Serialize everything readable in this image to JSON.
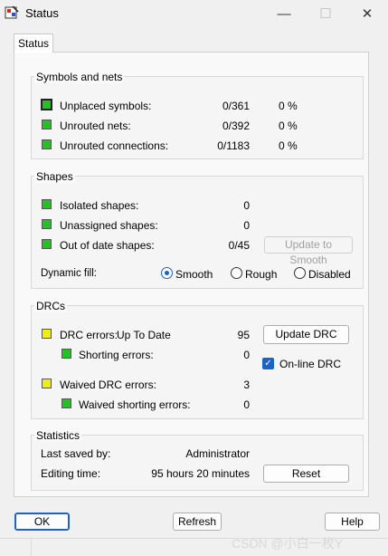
{
  "window": {
    "title": "Status",
    "minimize": "—",
    "maximize": "☐",
    "close": "✕"
  },
  "tab": "Status",
  "symbols": {
    "heading": "Symbols and nets",
    "rows": [
      {
        "label": "Unplaced symbols:",
        "value": "0/361",
        "percent": "0 %",
        "color": "#22c222"
      },
      {
        "label": "Unrouted nets:",
        "value": "0/392",
        "percent": "0 %",
        "color": "#22c222"
      },
      {
        "label": "Unrouted connections:",
        "value": "0/1183",
        "percent": "0 %",
        "color": "#22c222"
      }
    ]
  },
  "shapes": {
    "heading": "Shapes",
    "rows": [
      {
        "label": "Isolated shapes:",
        "value": "0"
      },
      {
        "label": "Unassigned shapes:",
        "value": "0"
      },
      {
        "label": "Out of date shapes:",
        "value": "0/45"
      }
    ],
    "update_button": "Update to Smooth",
    "dynamic_fill_label": "Dynamic fill:",
    "options": [
      "Smooth",
      "Rough",
      "Disabled"
    ],
    "selected": "Smooth"
  },
  "drc": {
    "heading": "DRCs",
    "drc_errors_label": "DRC errors:",
    "drc_status": "Up To Date",
    "drc_errors_value": "95",
    "shorting_label": "Shorting errors:",
    "shorting_value": "0",
    "waived_label": "Waived DRC errors:",
    "waived_value": "3",
    "waived_shorting_label": "Waived shorting errors:",
    "waived_shorting_value": "0",
    "update_button": "Update DRC",
    "online_label": "On-line DRC",
    "online_checked": true
  },
  "statistics": {
    "heading": "Statistics",
    "last_saved_label": "Last saved by:",
    "last_saved_value": "Administrator",
    "editing_time_label": "Editing time:",
    "editing_time_value": "95 hours 20 minutes",
    "reset_button": "Reset"
  },
  "footer": {
    "ok": "OK",
    "refresh": "Refresh",
    "help": "Help"
  },
  "watermark": "CSDN @小白一枚Y"
}
